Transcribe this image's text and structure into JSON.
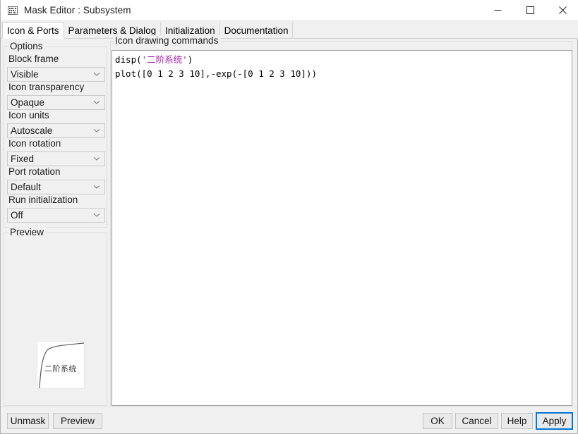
{
  "window": {
    "title": "Mask Editor : Subsystem",
    "icon": "mask-editor-icon",
    "controls": {
      "minimize": "—",
      "maximize": "□",
      "close": "✕"
    }
  },
  "tabs": [
    {
      "label": "Icon & Ports",
      "active": true
    },
    {
      "label": "Parameters & Dialog",
      "active": false
    },
    {
      "label": "Initialization",
      "active": false
    },
    {
      "label": "Documentation",
      "active": false
    }
  ],
  "left_panel": {
    "options_group_label": "Options",
    "fields": [
      {
        "label": "Block frame",
        "value": "Visible"
      },
      {
        "label": "Icon transparency",
        "value": "Opaque"
      },
      {
        "label": "Icon units",
        "value": "Autoscale"
      },
      {
        "label": "Icon rotation",
        "value": "Fixed"
      },
      {
        "label": "Port rotation",
        "value": "Default"
      },
      {
        "label": "Run initialization",
        "value": "Off"
      }
    ],
    "preview_group_label": "Preview",
    "preview_block_label": "二阶系统"
  },
  "editor": {
    "group_label": "Icon drawing commands",
    "lines": [
      {
        "pre": "disp(",
        "string": "'二阶系统'",
        "post": ")"
      },
      {
        "pre": "plot([0 1 2 3 10],-exp(-[0 1 2 3 10]))",
        "string": "",
        "post": ""
      }
    ],
    "line1_pre": "disp(",
    "line1_str": "'二阶系统'",
    "line1_post": ")",
    "line2": "plot([0 1 2 3 10],-exp(-[0 1 2 3 10]))"
  },
  "buttons": {
    "unmask": "Unmask",
    "preview": "Preview",
    "ok": "OK",
    "cancel": "Cancel",
    "help": "Help",
    "apply": "Apply"
  },
  "colors": {
    "window_bg": "#f0f0f0",
    "titlebar_bg": "#ffffff",
    "editor_bg": "#ffffff",
    "string_literal": "#a818a8",
    "focus_accent": "#0078d7",
    "text": "#1a1a1a"
  }
}
